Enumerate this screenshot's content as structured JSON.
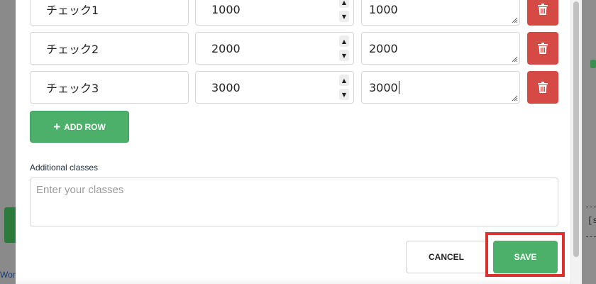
{
  "background": {
    "link_text": "Word",
    "right_text": "[s"
  },
  "rows": [
    {
      "label": "チェック1",
      "number": "1000",
      "value": "1000"
    },
    {
      "label": "チェック2",
      "number": "2000",
      "value": "2000"
    },
    {
      "label": "チェック3",
      "number": "3000",
      "value": "3000"
    }
  ],
  "spinner": {
    "up": "▲",
    "down": "▼"
  },
  "add_row": {
    "icon": "+",
    "label": "ADD ROW"
  },
  "additional_classes": {
    "label": "Additional classes",
    "placeholder": "Enter your classes",
    "value": ""
  },
  "footer": {
    "cancel_label": "CANCEL",
    "save_label": "SAVE"
  },
  "colors": {
    "save_green": "#4cb06a",
    "delete_red": "#d54a45",
    "highlight_red": "#d9322f"
  },
  "icons": {
    "delete": "trash-icon",
    "add": "plus-icon",
    "spinner_up": "triangle-up-icon",
    "spinner_down": "triangle-down-icon"
  }
}
